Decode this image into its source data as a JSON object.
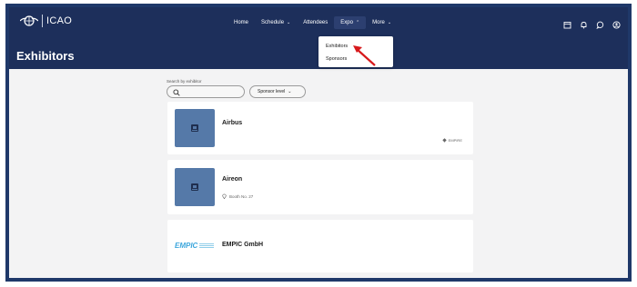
{
  "brand": {
    "name": "ICAO"
  },
  "nav": {
    "items": [
      {
        "label": "Home",
        "has_chevron": false
      },
      {
        "label": "Schedule",
        "has_chevron": true
      },
      {
        "label": "Attendees",
        "has_chevron": false
      },
      {
        "label": "Expo",
        "has_chevron": true,
        "active": true
      },
      {
        "label": "More",
        "has_chevron": true
      }
    ]
  },
  "header_icons": [
    "calendar-icon",
    "bell-icon",
    "chat-icon",
    "profile-icon"
  ],
  "dropdown": {
    "items": [
      {
        "label": "Exhibitors"
      },
      {
        "label": "Sponsors"
      }
    ]
  },
  "page": {
    "title": "Exhibitors"
  },
  "filters": {
    "search_label": "Search by exhibitor",
    "search_value": "",
    "sponsor_label": "Sponsor level"
  },
  "exhibitors": [
    {
      "name": "Airbus",
      "sponsor_tag": "EMPIRE",
      "booth": ""
    },
    {
      "name": "Aireon",
      "booth": "Booth No. 27",
      "sponsor_tag": ""
    },
    {
      "name": "EMPIC GmbH",
      "logo_text": "EMPIC",
      "booth": "",
      "sponsor_tag": ""
    }
  ],
  "colors": {
    "header_bg": "#1d2f5b",
    "frame_border": "#1f3869",
    "tile_bg": "#5579a8",
    "annotation_arrow": "#d7191c",
    "empic_blue": "#3ba6dc"
  }
}
